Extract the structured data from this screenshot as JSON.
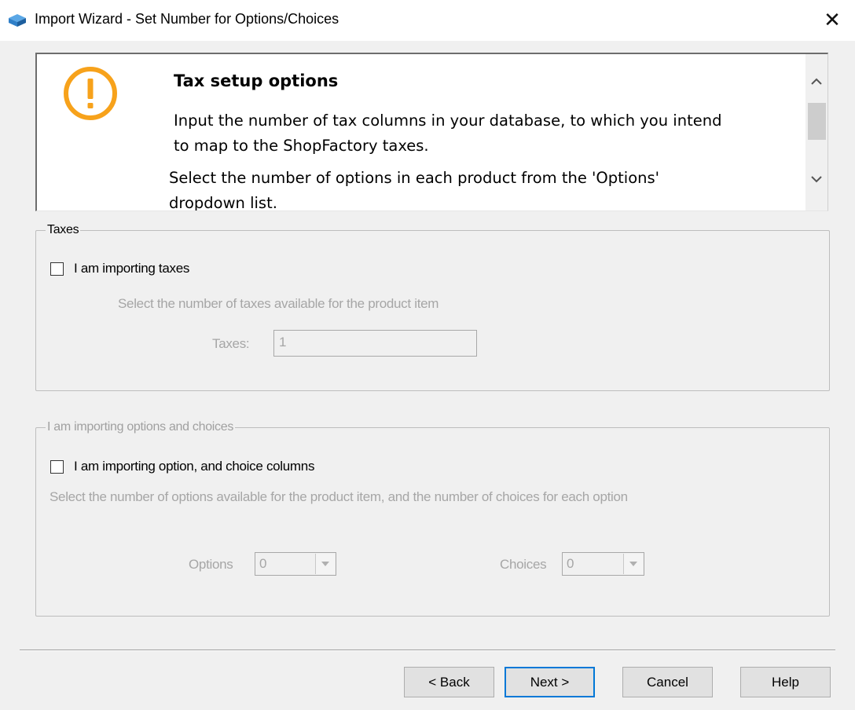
{
  "window": {
    "title": "Import Wizard - Set Number for Options/Choices",
    "close_glyph": "✕"
  },
  "info": {
    "heading": "Tax setup options",
    "line1": "Input the number of tax columns in your database, to which you intend\nto map to the ShopFactory taxes.",
    "line2": "Select the number of options in each product from the 'Options'\ndropdown list."
  },
  "taxes_group": {
    "legend": "Taxes",
    "checkbox_label": "I am importing taxes",
    "checked": false,
    "hint": "Select the number of taxes available for the product item",
    "taxes_label": "Taxes:",
    "taxes_value": "1"
  },
  "options_group": {
    "legend": "I am importing options and choices",
    "checkbox_label": "I am importing option, and choice columns",
    "checked": false,
    "hint": "Select the number of options available for the product item, and the number of choices for each option",
    "options_label": "Options",
    "options_value": "0",
    "choices_label": "Choices",
    "choices_value": "0"
  },
  "buttons": {
    "back": "< Back",
    "next": "Next >",
    "cancel": "Cancel",
    "help": "Help"
  },
  "icons": {
    "app": "import-wizard-icon",
    "warning": "warning-circle-icon",
    "accent_warning": "#f7a21b",
    "accent_focus": "#0078d7"
  }
}
